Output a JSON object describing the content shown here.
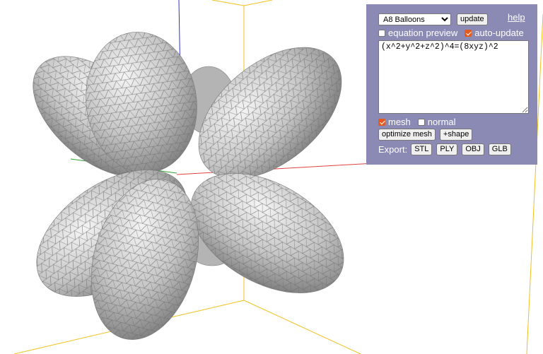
{
  "scene": {
    "axis_colors": {
      "x": "#e04040",
      "y": "#30a030",
      "z": "#3030d0"
    },
    "box_color": "#f0c020",
    "surface_color": "#c8c8c8"
  },
  "panel": {
    "background": "#8a8ab5",
    "preset_selected": "A8 Balloons",
    "update_label": "update",
    "help_label": "help",
    "equation_preview_label": "equation preview",
    "equation_preview_checked": false,
    "auto_update_label": "auto-update",
    "auto_update_checked": true,
    "equation": "(x^2+y^2+z^2)^4=(8xyz)^2",
    "mesh_label": "mesh",
    "mesh_checked": true,
    "normal_label": "normal",
    "normal_checked": false,
    "optimize_label": "optimize mesh",
    "add_shape_label": "+shape",
    "export_label": "Export:",
    "export_formats": [
      "STL",
      "PLY",
      "OBJ",
      "GLB"
    ]
  }
}
